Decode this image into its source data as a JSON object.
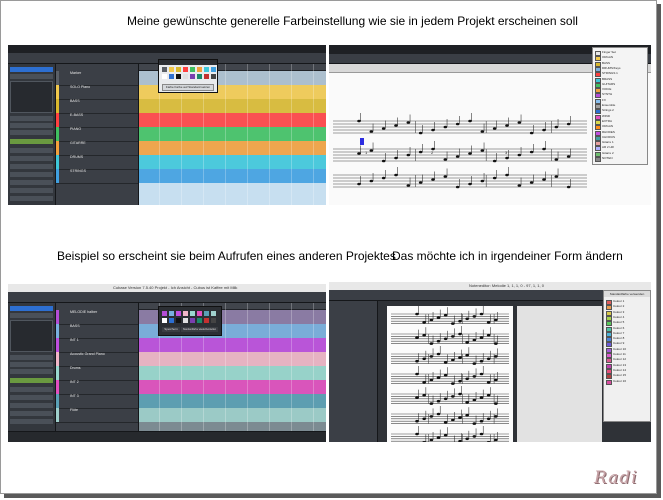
{
  "captions": {
    "top": "Meine gewünschte generelle Farbeinstellung wie sie in jedem Projekt erscheinen soll",
    "bottom_left": "Beispiel so erscheint sie beim Aufrufen eines anderen Projektes",
    "bottom_right": "Das möchte ich in irgendeiner Form ändern"
  },
  "watermark": "Radi",
  "shot_tl": {
    "tracks": [
      {
        "name": "Marker",
        "color": "#5a5f66"
      },
      {
        "name": "SOLO Piano",
        "color": "#f2c94c"
      },
      {
        "name": "BASS",
        "color": "#d9b82e"
      },
      {
        "name": "E-BASS",
        "color": "#ff4040"
      },
      {
        "name": "PIANO",
        "color": "#40c060"
      },
      {
        "name": "GITARRE",
        "color": "#f2a03c"
      },
      {
        "name": "DRUMS",
        "color": "#3ec7d9"
      },
      {
        "name": "STRINGS",
        "color": "#40a0e0"
      }
    ],
    "popup_button": "Farbe Farbe auf Standard setzen"
  },
  "shot_bl": {
    "window_title": "Cubase Version 7.5.40 Projekt - Ich Ansicht - Cubus ist Kaffee mit Milk",
    "tracks": [
      {
        "name": "MELODIE halber",
        "color": "#b44dd6"
      },
      {
        "name": "BASS",
        "color": "#7ab0e0"
      },
      {
        "name": "INT 1",
        "color": "#c04fe0"
      },
      {
        "name": "Acoustic Grand Piano",
        "color": "#f2b7c8"
      },
      {
        "name": "Drums",
        "color": "#9ad9cf"
      },
      {
        "name": "INT 2",
        "color": "#e34fc0"
      },
      {
        "name": "INT 3",
        "color": "#5aa0b5"
      },
      {
        "name": "Flöte",
        "color": "#9fd0cc"
      }
    ],
    "popup_left_button": "Speichern",
    "popup_right_button": "Standardfarbe wiederherstellen"
  },
  "shot_tr": {
    "colorlist": [
      {
        "label": "Finger Set",
        "color": "#e8e8e8"
      },
      {
        "label": "ORGAN",
        "color": "#f2c94c"
      },
      {
        "label": "BASS",
        "color": "#d9b82e"
      },
      {
        "label": "DRUMS/Keys",
        "color": "#7ab0e0"
      },
      {
        "label": "STRINGS 1",
        "color": "#ff4040"
      },
      {
        "label": "BRASS",
        "color": "#3ec7d9"
      },
      {
        "label": "GUITARS",
        "color": "#40c060"
      },
      {
        "label": "VOICE",
        "color": "#f2a03c"
      },
      {
        "label": "SYNTH",
        "color": "#b44dd6"
      },
      {
        "label": "FX",
        "color": "#8ac0f0"
      },
      {
        "label": "Ensemble",
        "color": "#a0a0a0"
      },
      {
        "label": "Strings 2",
        "color": "#2c6fd1"
      },
      {
        "label": "WIND",
        "color": "#e34fc0"
      },
      {
        "label": "EXTRA",
        "color": "#d9d94c"
      },
      {
        "label": "ORGAN",
        "color": "#ff8c1a"
      },
      {
        "label": "RHODES",
        "color": "#c04fe0"
      },
      {
        "label": "CHORUS",
        "color": "#40a0a0"
      },
      {
        "label": "Gitarre 1",
        "color": "#e8a0a0"
      },
      {
        "label": "AR 2 HR",
        "color": "#b0b0ff"
      },
      {
        "label": "Gitarre 2",
        "color": "#70c070"
      },
      {
        "label": "NOTEN",
        "color": "#888888"
      }
    ],
    "bar_numbers": [
      "1",
      "2",
      "3"
    ]
  },
  "shot_br": {
    "window_title": "Noteneditor: Melodie 1, 1, 1, 0 - 97, 1, 1, 0",
    "colorlist_title": "Standardfarbe verwenden",
    "colorlist": [
      {
        "label": "Colour 1",
        "color": "#e05b5b"
      },
      {
        "label": "Colour 2",
        "color": "#e89b4f"
      },
      {
        "label": "Colour 3",
        "color": "#d9c84c"
      },
      {
        "label": "Colour 4",
        "color": "#a6d24c"
      },
      {
        "label": "Colour 5",
        "color": "#58c95a"
      },
      {
        "label": "Colour 6",
        "color": "#4cc4a3"
      },
      {
        "label": "Colour 7",
        "color": "#4cb4d9"
      },
      {
        "label": "Colour 8",
        "color": "#4c83d9"
      },
      {
        "label": "Colour 9",
        "color": "#6a5ad9"
      },
      {
        "label": "Colour 10",
        "color": "#a45ad9"
      },
      {
        "label": "Colour 11",
        "color": "#d95ad0"
      },
      {
        "label": "Colour 12",
        "color": "#d95a8e"
      },
      {
        "label": "Colour 13",
        "color": "#c03fae"
      },
      {
        "label": "Colour 14",
        "color": "#e34f7a"
      },
      {
        "label": "Colour 15",
        "color": "#b04040"
      },
      {
        "label": "Colour 16",
        "color": "#d94ca0"
      }
    ]
  }
}
